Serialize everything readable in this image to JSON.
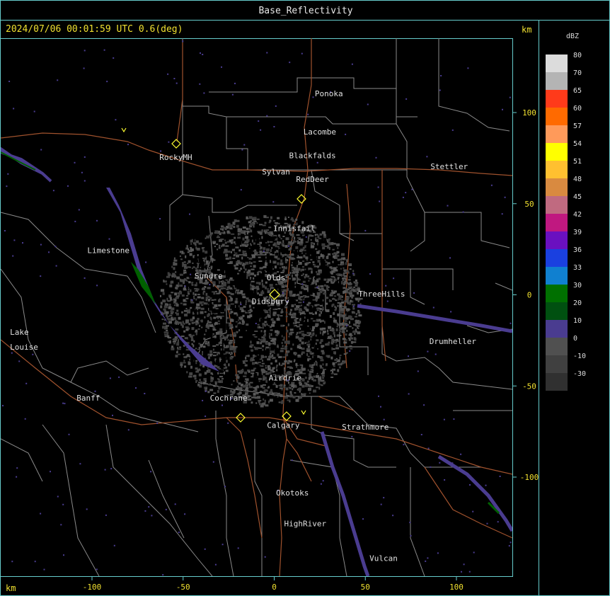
{
  "title": "Base_Reflectivity",
  "timestamp": "2024/07/06 00:01:59 UTC 0.6(deg)",
  "axis": {
    "unit_label": "km",
    "x_ticks": [
      {
        "label": "-100",
        "value": -100
      },
      {
        "label": "-50",
        "value": -50
      },
      {
        "label": "0",
        "value": 0
      },
      {
        "label": "50",
        "value": 50
      },
      {
        "label": "100",
        "value": 100
      }
    ],
    "y_ticks": [
      {
        "label": "100",
        "value": 100
      },
      {
        "label": "50",
        "value": 50
      },
      {
        "label": "0",
        "value": 0
      },
      {
        "label": "-50",
        "value": -50
      },
      {
        "label": "-100",
        "value": -100
      }
    ]
  },
  "legend": {
    "title": "dBZ",
    "entries": [
      {
        "label": "80",
        "color": "#dcdcdc"
      },
      {
        "label": "70",
        "color": "#b4b4b4"
      },
      {
        "label": "65",
        "color": "#ff3a1a"
      },
      {
        "label": "60",
        "color": "#ff6a00"
      },
      {
        "label": "57",
        "color": "#ff9a5a"
      },
      {
        "label": "54",
        "color": "#ffff00"
      },
      {
        "label": "51",
        "color": "#ffc030"
      },
      {
        "label": "48",
        "color": "#d98a40"
      },
      {
        "label": "45",
        "color": "#c06a80"
      },
      {
        "label": "42",
        "color": "#c01880"
      },
      {
        "label": "39",
        "color": "#6a10c0"
      },
      {
        "label": "36",
        "color": "#1a40e0"
      },
      {
        "label": "33",
        "color": "#1080d0"
      },
      {
        "label": "30",
        "color": "#007000"
      },
      {
        "label": "20",
        "color": "#005010"
      },
      {
        "label": "10",
        "color": "#4a3c90"
      },
      {
        "label": "0",
        "color": "#505050"
      },
      {
        "label": "-10",
        "color": "#404040"
      },
      {
        "label": "-30",
        "color": "#303030"
      }
    ]
  },
  "places": [
    {
      "name": "Ponoka",
      "x": 30,
      "y": 109
    },
    {
      "name": "Lacombe",
      "x": 25,
      "y": 88
    },
    {
      "name": "Blackfalds",
      "x": 21,
      "y": 75
    },
    {
      "name": "Sylvan",
      "x": 1,
      "y": 66
    },
    {
      "name": "RedDeer",
      "x": 21,
      "y": 62
    },
    {
      "name": "Stettler",
      "x": 96,
      "y": 69
    },
    {
      "name": "RockyMH",
      "x": -54,
      "y": 74
    },
    {
      "name": "Innisfail",
      "x": 11,
      "y": 35
    },
    {
      "name": "Limestone",
      "x": -91,
      "y": 23
    },
    {
      "name": "Sundre",
      "x": -36,
      "y": 9
    },
    {
      "name": "Olds",
      "x": 1,
      "y": 8
    },
    {
      "name": "Didsbury",
      "x": -2,
      "y": -5
    },
    {
      "name": "ThreeHills",
      "x": 59,
      "y": -1
    },
    {
      "name": "Drumheller",
      "x": 98,
      "y": -27
    },
    {
      "name": "Lake",
      "x": -145,
      "y": -22
    },
    {
      "name": "Louise",
      "x": -145,
      "y": -30
    },
    {
      "name": "Airdrie",
      "x": 6,
      "y": -47
    },
    {
      "name": "Banff",
      "x": -102,
      "y": -58
    },
    {
      "name": "Cochrane",
      "x": -25,
      "y": -58
    },
    {
      "name": "Calgary",
      "x": 5,
      "y": -73
    },
    {
      "name": "Strathmore",
      "x": 50,
      "y": -74
    },
    {
      "name": "Okotoks",
      "x": 10,
      "y": -110
    },
    {
      "name": "HighRiver",
      "x": 17,
      "y": -127
    },
    {
      "name": "Vulcan",
      "x": 60,
      "y": -146
    }
  ]
}
